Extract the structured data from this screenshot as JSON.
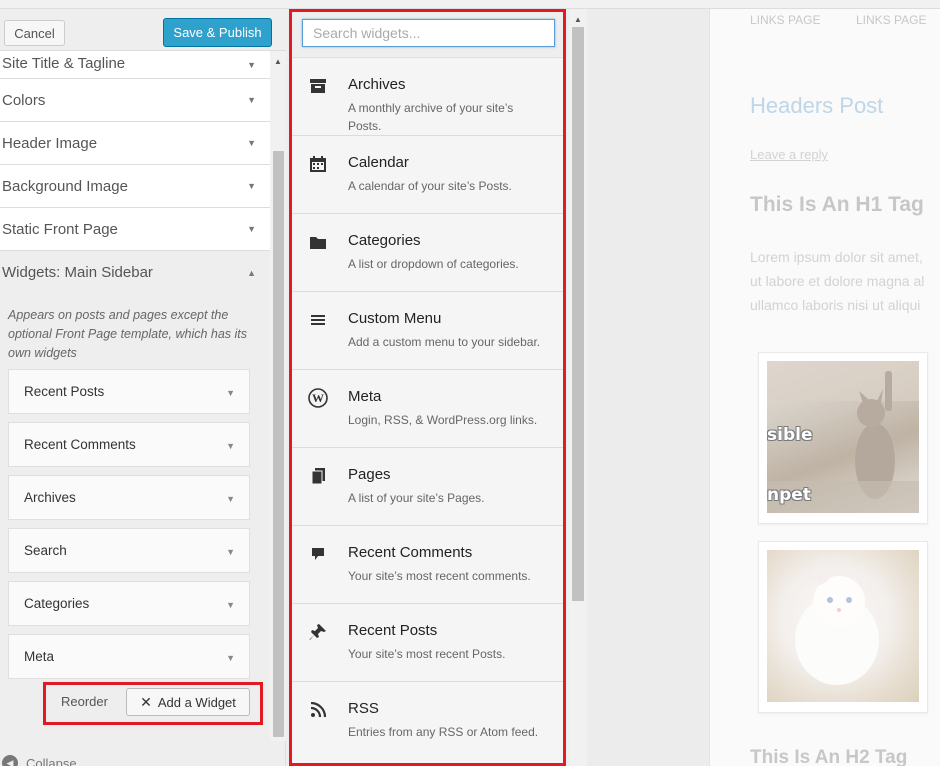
{
  "header": {
    "cancel_label": "Cancel",
    "publish_label": "Save & Publish"
  },
  "sections": [
    {
      "label": "Site Title & Tagline"
    },
    {
      "label": "Colors"
    },
    {
      "label": "Header Image"
    },
    {
      "label": "Background Image"
    },
    {
      "label": "Static Front Page"
    },
    {
      "label": "Widgets: Main Sidebar"
    }
  ],
  "sidebar": {
    "description": "Appears on posts and pages except the optional Front Page template, which has its own widgets",
    "widgets": [
      {
        "label": "Recent Posts"
      },
      {
        "label": "Recent Comments"
      },
      {
        "label": "Archives"
      },
      {
        "label": "Search"
      },
      {
        "label": "Categories"
      },
      {
        "label": "Meta"
      }
    ],
    "reorder_label": "Reorder",
    "add_widget_label": "Add a Widget",
    "collapse_label": "Collapse"
  },
  "available": {
    "search_placeholder": "Search widgets...",
    "widgets": [
      {
        "title": "Archives",
        "desc": "A monthly archive of your site’s Posts.",
        "icon": "archive-icon"
      },
      {
        "title": "Calendar",
        "desc": "A calendar of your site’s Posts.",
        "icon": "calendar-icon"
      },
      {
        "title": "Categories",
        "desc": "A list or dropdown of categories.",
        "icon": "folder-icon"
      },
      {
        "title": "Custom Menu",
        "desc": "Add a custom menu to your sidebar.",
        "icon": "menu-icon"
      },
      {
        "title": "Meta",
        "desc": "Login, RSS, & WordPress.org links.",
        "icon": "wordpress-icon"
      },
      {
        "title": "Pages",
        "desc": "A list of your site’s Pages.",
        "icon": "pages-icon"
      },
      {
        "title": "Recent Comments",
        "desc": "Your site’s most recent comments.",
        "icon": "comment-icon"
      },
      {
        "title": "Recent Posts",
        "desc": "Your site’s most recent Posts.",
        "icon": "pin-icon"
      },
      {
        "title": "RSS",
        "desc": "Entries from any RSS or Atom feed.",
        "icon": "rss-icon"
      }
    ]
  },
  "preview": {
    "nav": [
      "LINKS PAGE",
      "LINKS PAGE"
    ],
    "post_title": "Headers Post",
    "leave_reply": "Leave a reply",
    "h1": "This Is An H1 Tag",
    "lorem": [
      "Lorem ipsum dolor sit amet,",
      "ut labore et dolore magna al",
      "ullamco laboris nisi ut aliqui"
    ],
    "meme_top": "sible",
    "meme_bottom": "npet",
    "h2": "This Is An H2 Tag"
  },
  "colors": {
    "accent": "#2ea2cc",
    "highlight": "#e01b24"
  }
}
